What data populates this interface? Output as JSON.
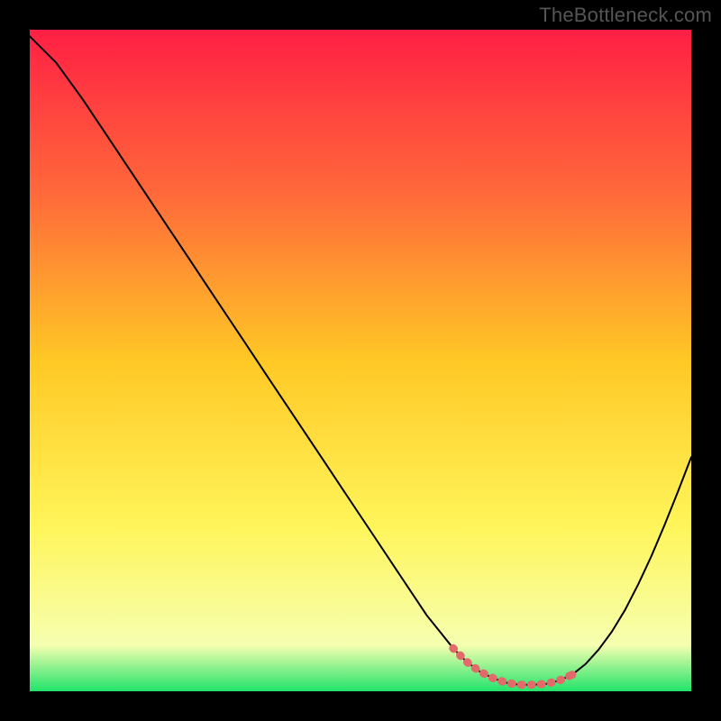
{
  "watermark": "TheBottleneck.com",
  "colors": {
    "highlight": "#e26a6a",
    "curve": "#000000",
    "gradient_stops": [
      {
        "offset": "0%",
        "color": "#ff1f44"
      },
      {
        "offset": "25%",
        "color": "#ff6a3a"
      },
      {
        "offset": "50%",
        "color": "#ffc825"
      },
      {
        "offset": "75%",
        "color": "#fff55a"
      },
      {
        "offset": "93%",
        "color": "#f6ffb0"
      },
      {
        "offset": "100%",
        "color": "#21e36b"
      }
    ]
  },
  "chart_data": {
    "type": "line",
    "title": "",
    "xlabel": "",
    "ylabel": "",
    "xlim": [
      0,
      100
    ],
    "ylim": [
      0,
      100
    ],
    "x": [
      0,
      4,
      8,
      12,
      16,
      20,
      24,
      28,
      32,
      36,
      40,
      44,
      48,
      52,
      56,
      60,
      62,
      64,
      66,
      68,
      70,
      72,
      74,
      76,
      78,
      80,
      82,
      84,
      86,
      88,
      90,
      92,
      94,
      96,
      98,
      100
    ],
    "values": [
      99,
      95,
      89.5,
      83.5,
      77.5,
      71.5,
      65.5,
      59.5,
      53.5,
      47.5,
      41.5,
      35.5,
      29.5,
      23.5,
      17.5,
      11.5,
      9,
      6.5,
      4.5,
      3,
      2,
      1.3,
      1,
      1,
      1.1,
      1.6,
      2.5,
      4.1,
      6.3,
      9,
      12.3,
      16.2,
      20.5,
      25.2,
      30.2,
      35.4
    ],
    "highlight_range_x": [
      64,
      82
    ],
    "highlight_style": {
      "stroke_width": 9,
      "dasharray": "1 10"
    }
  }
}
